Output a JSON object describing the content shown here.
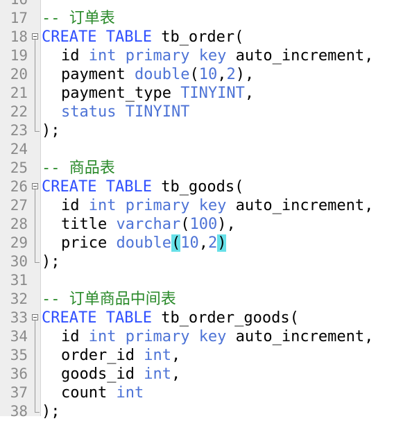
{
  "editor": {
    "lines": [
      {
        "num": "16",
        "tokens": []
      },
      {
        "num": "17",
        "tokens": [
          {
            "t": "-- ",
            "c": "tok-comment"
          },
          {
            "t": "订单表",
            "c": "tok-comment"
          }
        ]
      },
      {
        "num": "18",
        "fold": "open",
        "tokens": [
          {
            "t": "CREATE TABLE",
            "c": "tok-kw"
          },
          {
            "t": " tb_order(",
            "c": "tok-plain"
          }
        ]
      },
      {
        "num": "19",
        "fold": "line",
        "indent": true,
        "tokens": [
          {
            "t": "id ",
            "c": "tok-plain"
          },
          {
            "t": "int primary key",
            "c": "tok-type"
          },
          {
            "t": " auto_increment,",
            "c": "tok-plain"
          }
        ]
      },
      {
        "num": "20",
        "fold": "line",
        "indent": true,
        "tokens": [
          {
            "t": "payment ",
            "c": "tok-plain"
          },
          {
            "t": "double",
            "c": "tok-type"
          },
          {
            "t": "(",
            "c": "tok-plain"
          },
          {
            "t": "10",
            "c": "tok-num"
          },
          {
            "t": ",",
            "c": "tok-plain"
          },
          {
            "t": "2",
            "c": "tok-num"
          },
          {
            "t": "),",
            "c": "tok-plain"
          }
        ]
      },
      {
        "num": "21",
        "fold": "line",
        "indent": true,
        "tokens": [
          {
            "t": "payment_type ",
            "c": "tok-plain"
          },
          {
            "t": "TINYINT",
            "c": "tok-type"
          },
          {
            "t": ",",
            "c": "tok-plain"
          }
        ]
      },
      {
        "num": "22",
        "fold": "line",
        "indent": true,
        "tokens": [
          {
            "t": "status TINYINT",
            "c": "tok-status"
          }
        ]
      },
      {
        "num": "23",
        "fold": "end",
        "tokens": [
          {
            "t": ");",
            "c": "tok-plain"
          }
        ]
      },
      {
        "num": "24",
        "tokens": []
      },
      {
        "num": "25",
        "tokens": [
          {
            "t": "-- ",
            "c": "tok-comment"
          },
          {
            "t": "商品表",
            "c": "tok-comment"
          }
        ]
      },
      {
        "num": "26",
        "fold": "open",
        "tokens": [
          {
            "t": "CREATE TABLE",
            "c": "tok-kw"
          },
          {
            "t": " tb_goods(",
            "c": "tok-plain"
          }
        ]
      },
      {
        "num": "27",
        "fold": "line",
        "indent": true,
        "tokens": [
          {
            "t": "id ",
            "c": "tok-plain"
          },
          {
            "t": "int primary key",
            "c": "tok-type"
          },
          {
            "t": " auto_increment,",
            "c": "tok-plain"
          }
        ]
      },
      {
        "num": "28",
        "fold": "line",
        "indent": true,
        "tokens": [
          {
            "t": "title ",
            "c": "tok-plain"
          },
          {
            "t": "varchar",
            "c": "tok-type"
          },
          {
            "t": "(",
            "c": "tok-plain"
          },
          {
            "t": "100",
            "c": "tok-num"
          },
          {
            "t": "),",
            "c": "tok-plain"
          }
        ]
      },
      {
        "num": "29",
        "fold": "line",
        "indent": true,
        "tokens": [
          {
            "t": "price ",
            "c": "tok-plain"
          },
          {
            "t": "double",
            "c": "tok-type"
          },
          {
            "t": "(",
            "c": "tok-plain hl"
          },
          {
            "t": "10",
            "c": "tok-num"
          },
          {
            "t": ",",
            "c": "tok-plain"
          },
          {
            "t": "2",
            "c": "tok-num"
          },
          {
            "t": ")",
            "c": "tok-plain hl"
          }
        ]
      },
      {
        "num": "30",
        "fold": "end",
        "tokens": [
          {
            "t": ");",
            "c": "tok-plain"
          }
        ]
      },
      {
        "num": "31",
        "tokens": []
      },
      {
        "num": "32",
        "tokens": [
          {
            "t": "-- ",
            "c": "tok-comment"
          },
          {
            "t": "订单商品中间表",
            "c": "tok-comment"
          }
        ]
      },
      {
        "num": "33",
        "fold": "open",
        "tokens": [
          {
            "t": "CREATE TABLE",
            "c": "tok-kw"
          },
          {
            "t": " tb_order_goods(",
            "c": "tok-plain"
          }
        ]
      },
      {
        "num": "34",
        "fold": "line",
        "indent": true,
        "tokens": [
          {
            "t": "id ",
            "c": "tok-plain"
          },
          {
            "t": "int primary key",
            "c": "tok-type"
          },
          {
            "t": " auto_increment,",
            "c": "tok-plain"
          }
        ]
      },
      {
        "num": "35",
        "fold": "line",
        "indent": true,
        "tokens": [
          {
            "t": "order_id ",
            "c": "tok-plain"
          },
          {
            "t": "int",
            "c": "tok-type"
          },
          {
            "t": ",",
            "c": "tok-plain"
          }
        ]
      },
      {
        "num": "36",
        "fold": "line",
        "indent": true,
        "tokens": [
          {
            "t": "goods_id ",
            "c": "tok-plain"
          },
          {
            "t": "int",
            "c": "tok-type"
          },
          {
            "t": ",",
            "c": "tok-plain"
          }
        ]
      },
      {
        "num": "37",
        "fold": "line",
        "indent": true,
        "tokens": [
          {
            "t": "count ",
            "c": "tok-plain"
          },
          {
            "t": "int",
            "c": "tok-type"
          }
        ]
      },
      {
        "num": "38",
        "fold": "end",
        "tokens": [
          {
            "t": ");",
            "c": "tok-plain"
          }
        ]
      }
    ]
  }
}
